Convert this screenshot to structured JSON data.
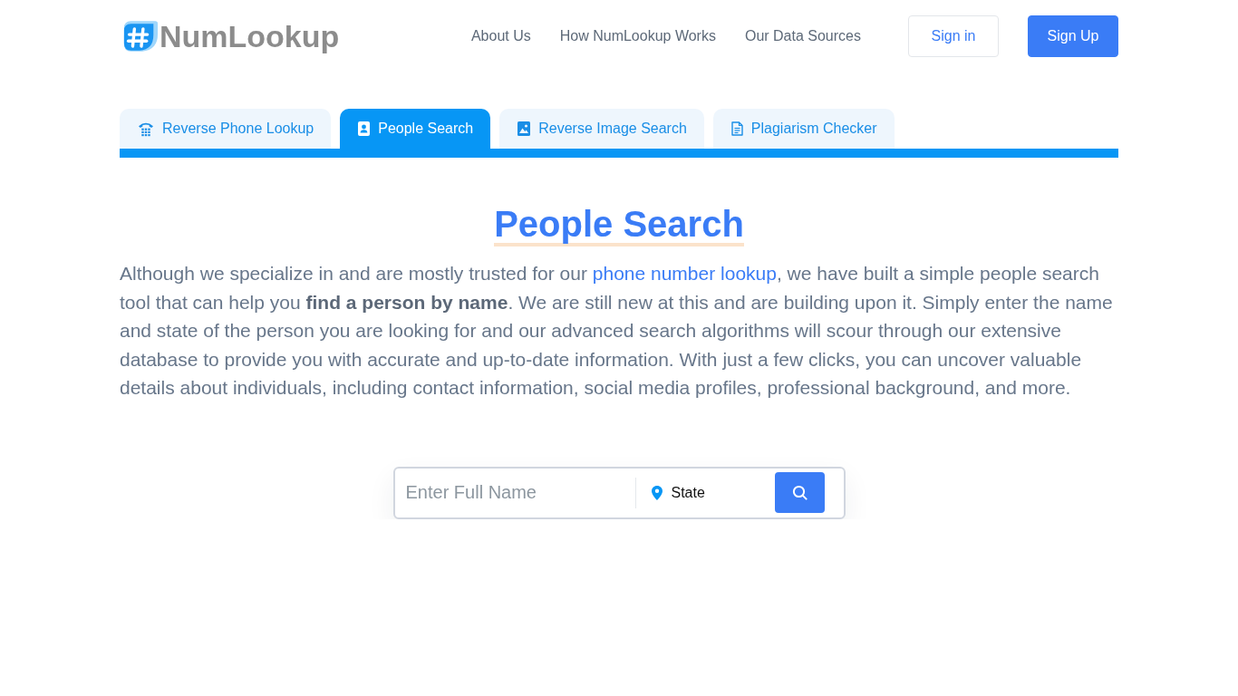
{
  "header": {
    "logo": {
      "text": "NumLookup"
    },
    "nav_links": [
      {
        "label": "About Us"
      },
      {
        "label": "How NumLookup Works"
      },
      {
        "label": "Our Data Sources"
      }
    ],
    "buttons": [
      {
        "label": "Sign in",
        "kind": "outline"
      },
      {
        "label": "Sign Up",
        "kind": "primary"
      }
    ]
  },
  "tabs": [
    {
      "label": "Reverse Phone Lookup",
      "selected": false
    },
    {
      "label": "People Search",
      "selected": true
    },
    {
      "label": "Reverse Image Search",
      "selected": false
    },
    {
      "label": "Plagiarism Checker",
      "selected": false
    }
  ],
  "heading": "People Search",
  "intro": {
    "text_before": "Although we specialize in and are mostly trusted for our ",
    "link": "phone number lookup",
    "text_after": ", we have built a simple people search tool that can help you **find a person by name**. We are still new at this and are building upon it. Simply enter the name and state of the person you are looking for and our advanced search algorithms will scour through our extensive database to provide you with accurate and up-to-date information. With just a few clicks, you can uncover valuable details about individuals, including contact information, social media profiles, professional background, and more."
  },
  "search": {
    "name_field": {
      "placeholder": "Enter Full Name"
    },
    "state_field": {
      "value": "State"
    }
  }
}
